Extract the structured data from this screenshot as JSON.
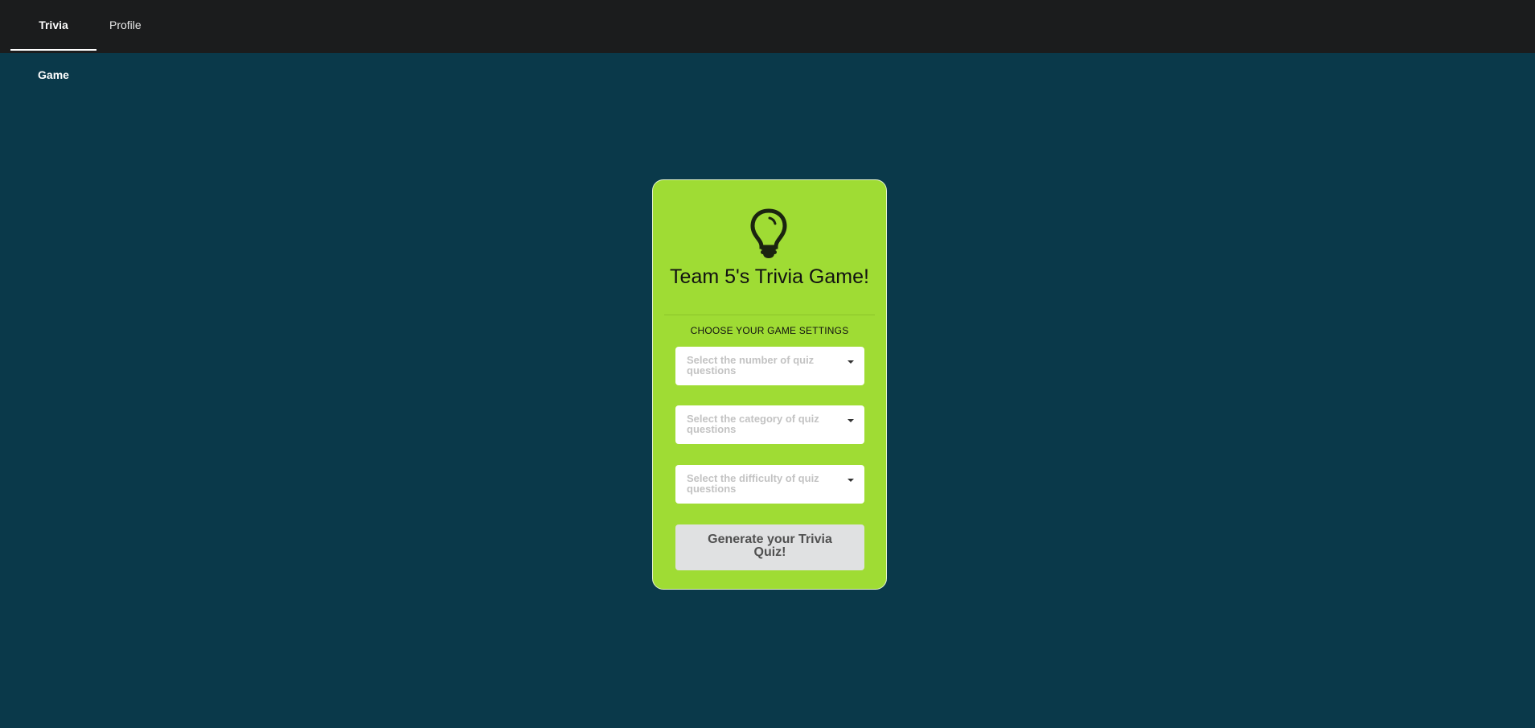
{
  "nav": {
    "items": [
      {
        "label": "Trivia Game"
      },
      {
        "label": "Profile"
      }
    ]
  },
  "card": {
    "icon": "lightbulb-icon",
    "title": "Team 5's Trivia Game!",
    "subtitle": "CHOOSE YOUR GAME SETTINGS",
    "selects": [
      {
        "placeholder": "Select the number of quiz questions"
      },
      {
        "placeholder": "Select the category of quiz questions"
      },
      {
        "placeholder": "Select the difficulty of quiz questions"
      }
    ],
    "button_label": "Generate your Trivia Quiz!"
  },
  "colors": {
    "background": "#0a394a",
    "topbar": "#1b1c1d",
    "card": "#9fdc34",
    "button": "#e0e1e2"
  }
}
